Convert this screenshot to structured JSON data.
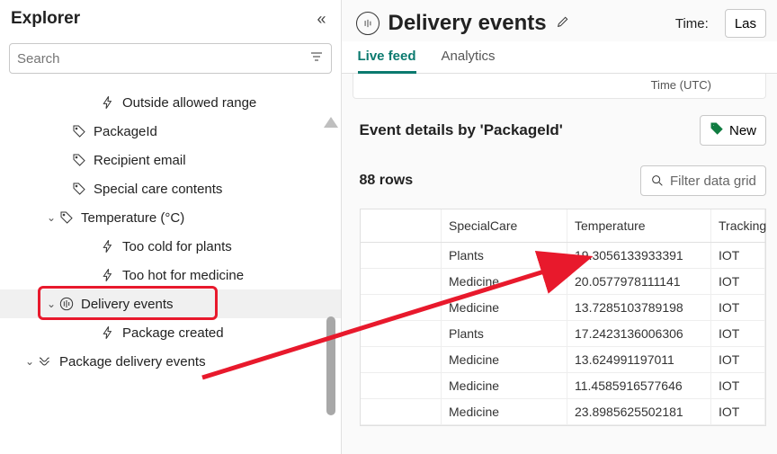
{
  "sidebar": {
    "title": "Explorer",
    "search_placeholder": "Search",
    "items": [
      {
        "label": "Outside allowed range",
        "icon": "bolt",
        "indent": "indent-3"
      },
      {
        "label": "PackageId",
        "icon": "tag",
        "indent": "indent-2"
      },
      {
        "label": "Recipient email",
        "icon": "tag",
        "indent": "indent-2"
      },
      {
        "label": "Special care contents",
        "icon": "tag",
        "indent": "indent-2"
      },
      {
        "label": "Temperature (°C)",
        "icon": "tag",
        "indent": "indent-1b",
        "chevron": true
      },
      {
        "label": "Too cold for plants",
        "icon": "bolt",
        "indent": "indent-3"
      },
      {
        "label": "Too hot for medicine",
        "icon": "bolt",
        "indent": "indent-3"
      },
      {
        "label": "Delivery events",
        "icon": "stream",
        "indent": "indent-1b",
        "chevron": true,
        "selected": true,
        "highlighted": true
      },
      {
        "label": "Package created",
        "icon": "bolt",
        "indent": "indent-3"
      },
      {
        "label": "Package delivery events",
        "icon": "flow",
        "indent": "indent-0",
        "chevron": true
      }
    ]
  },
  "header": {
    "title": "Delivery events",
    "time_label": "Time:",
    "time_value": "Las"
  },
  "tabs": [
    {
      "label": "Live feed",
      "active": true
    },
    {
      "label": "Analytics",
      "active": false
    }
  ],
  "time_utc_label": "Time (UTC)",
  "section": {
    "title": "Event details by 'PackageId'",
    "new_button": "New",
    "row_count": "88 rows",
    "filter_placeholder": "Filter data grid"
  },
  "grid": {
    "columns": [
      "",
      "SpecialCare",
      "Temperature",
      "Tracking"
    ],
    "rows": [
      [
        "",
        "Plants",
        "19.3056133933391",
        "IOT"
      ],
      [
        "",
        "Medicine",
        "20.0577978111141",
        "IOT"
      ],
      [
        "",
        "Medicine",
        "13.7285103789198",
        "IOT"
      ],
      [
        "",
        "Plants",
        "17.2423136006306",
        "IOT"
      ],
      [
        "",
        "Medicine",
        "13.624991197011",
        "IOT"
      ],
      [
        "",
        "Medicine",
        "11.4585916577646",
        "IOT"
      ],
      [
        "",
        "Medicine",
        "23.8985625502181",
        "IOT"
      ]
    ]
  }
}
